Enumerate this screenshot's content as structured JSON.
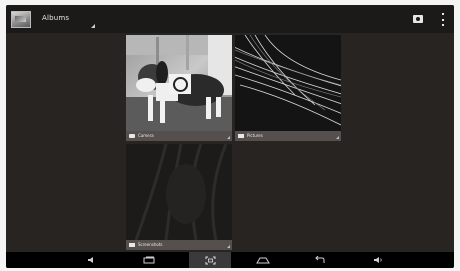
{
  "action_bar": {
    "title": "Albums",
    "app_icon": "gallery-icon",
    "camera_icon": "camera-icon",
    "overflow_icon": "overflow-menu-icon"
  },
  "albums": [
    {
      "label": "Camera",
      "icon": "camera-icon"
    },
    {
      "label": "Pictures",
      "icon": "folder-icon"
    },
    {
      "label": "Screenshots",
      "icon": "folder-icon"
    }
  ],
  "nav_bar": {
    "buttons": [
      "volume-down-icon",
      "recent-apps-icon",
      "screenshot-icon",
      "home-icon",
      "back-icon",
      "volume-up-icon"
    ]
  },
  "colors": {
    "background": "#272421",
    "action_bar": "#1c1a18",
    "nav_bar": "#000000",
    "label_bar": "#5a5652"
  }
}
